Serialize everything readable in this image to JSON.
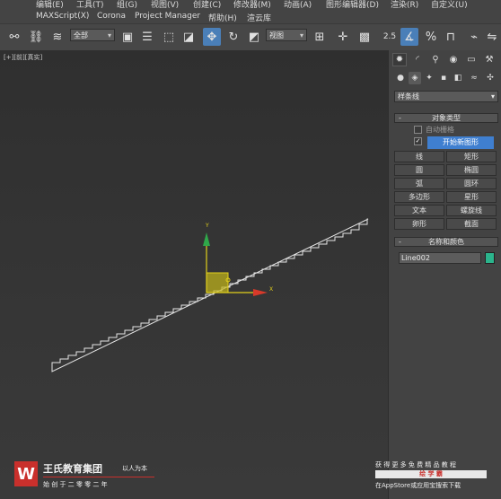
{
  "menu": {
    "row1": [
      "编辑(E)",
      "工具(T)",
      "组(G)",
      "视图(V)",
      "创建(C)",
      "修改器(M)",
      "动画(A)",
      "图形编辑器(D)",
      "渲染(R)",
      "自定义(U)"
    ],
    "row2": [
      "MAXScript(X)",
      "Corona",
      "Project Manager",
      "帮助(H)",
      "渲云库"
    ]
  },
  "toolbar": {
    "selection_filter": "全部",
    "reference_coord": "视图",
    "angle_snap": "2.5",
    "percent_snap": "%"
  },
  "viewport": {
    "label": "[+][前][真实]",
    "axis_x": "X",
    "axis_y": "Y",
    "accent_color": "#e2d01c"
  },
  "panel": {
    "category_dropdown": "样条线",
    "object_type_title": "对象类型",
    "auto_grid": "自动栅格",
    "start_new_shape": "开始新图形",
    "buttons": [
      "线",
      "矩形",
      "圆",
      "椭圆",
      "弧",
      "圆环",
      "多边形",
      "星形",
      "文本",
      "螺旋线",
      "卵形",
      "截面"
    ],
    "name_color_title": "名称和颜色",
    "object_name": "Line002",
    "object_color": "#2bb48c"
  },
  "watermark": {
    "brand": "王氏教育集团",
    "slogan": "以人为本",
    "founded": "始 创 于 二 零 零 二 年",
    "promo_line1": "获 得 更 多 免 费 精 品 教 程",
    "promo_brand": "绘 学 霸",
    "promo_line2": "在AppStore或应用宝搜索下载"
  }
}
